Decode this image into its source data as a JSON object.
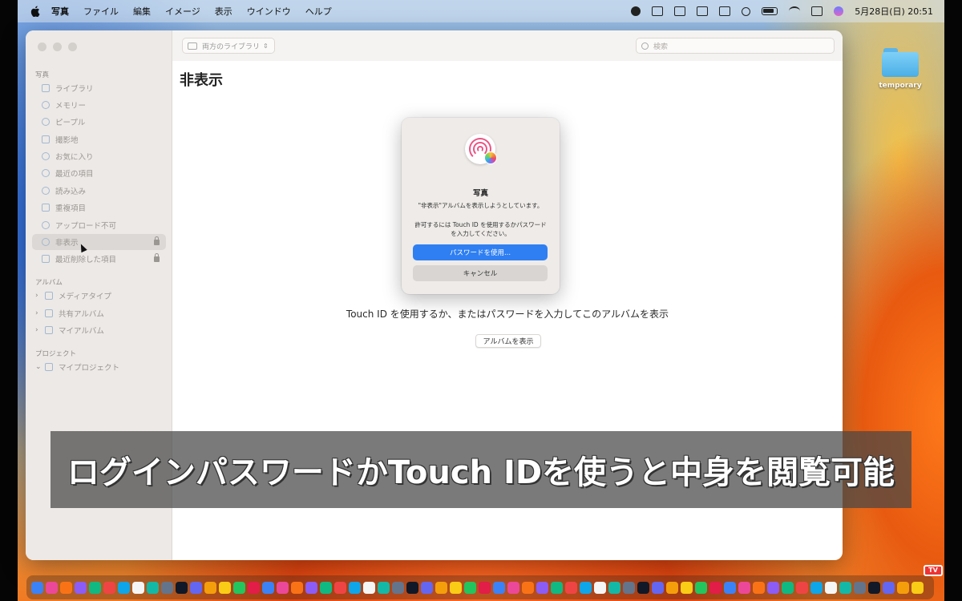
{
  "menubar": {
    "items": [
      "写真",
      "ファイル",
      "編集",
      "イメージ",
      "表示",
      "ウインドウ",
      "ヘルプ"
    ],
    "datetime": "5月28日(日) 20:51"
  },
  "desktop": {
    "folder_name": "temporary"
  },
  "window": {
    "toolbar": {
      "library_select": "両方のライブラリ",
      "search_placeholder": "検索"
    },
    "sidebar": {
      "photos_section": "写真",
      "items": [
        {
          "label": "ライブラリ",
          "icon": "library-icon"
        },
        {
          "label": "メモリー",
          "icon": "memories-icon"
        },
        {
          "label": "ピープル",
          "icon": "people-icon"
        },
        {
          "label": "撮影地",
          "icon": "places-icon"
        },
        {
          "label": "お気に入り",
          "icon": "heart-icon"
        },
        {
          "label": "最近の項目",
          "icon": "clock-icon"
        },
        {
          "label": "読み込み",
          "icon": "import-icon"
        },
        {
          "label": "重複項目",
          "icon": "duplicates-icon"
        },
        {
          "label": "アップロード不可",
          "icon": "cloud-icon"
        },
        {
          "label": "非表示",
          "icon": "eye-icon"
        },
        {
          "label": "最近削除した項目",
          "icon": "trash-icon"
        }
      ],
      "albums_section": "アルバム",
      "albums": [
        "メディアタイプ",
        "共有アルバム",
        "マイアルバム"
      ],
      "projects_section": "プロジェクト",
      "projects": [
        "マイプロジェクト"
      ]
    },
    "page_title": "非表示",
    "prompt": "Touch ID を使用するか、またはパスワードを入力してこのアルバムを表示",
    "show_album_button": "アルバムを表示"
  },
  "dialog": {
    "title": "写真",
    "message": "\"非表示\"アルバムを表示しようとしています。",
    "instruction": "許可するには Touch ID を使用するかパスワードを入力してください。",
    "use_password": "パスワードを使用...",
    "cancel": "キャンセル"
  },
  "caption": "ログインパスワードかTouch IDを使うと中身を閲覧可能",
  "watermark": "TV",
  "colors": {
    "accent": "#2f7ff2",
    "caption_bg": "#464646"
  }
}
